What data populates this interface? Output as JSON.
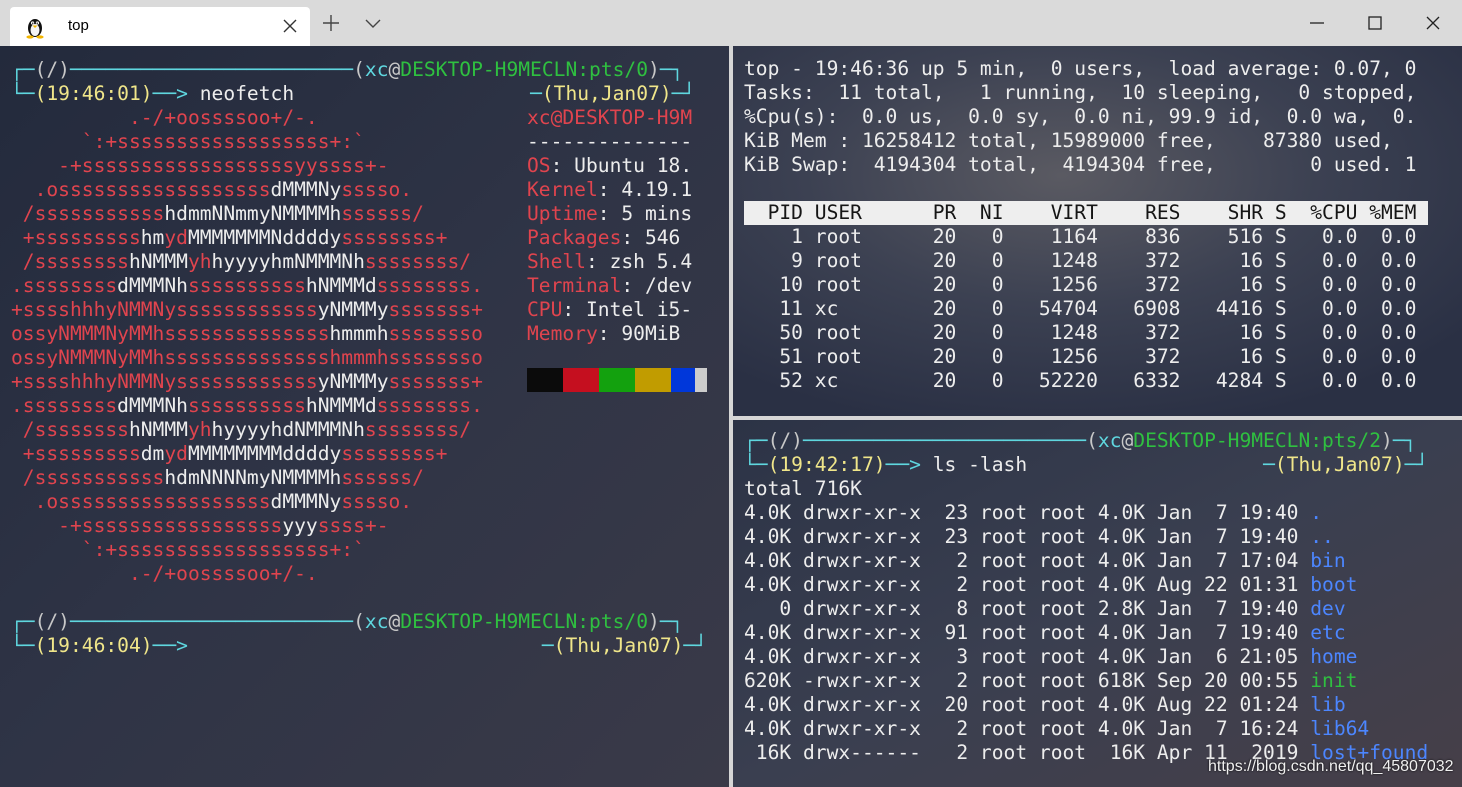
{
  "window": {
    "tab_title": "top",
    "tab_icon": "linux-penguin-icon",
    "new_tab_icon": "plus-icon",
    "dropdown_icon": "chevron-down-icon"
  },
  "colors": {
    "cyan": "#5fd7df",
    "green": "#2fc040",
    "yellow": "#f0e68a",
    "red": "#e0444e",
    "blue": "#4c86ff"
  },
  "left_pane": {
    "prompt1": {
      "path": "(/)",
      "user": "xc",
      "at": "@",
      "host": "DESKTOP-H9MECLN:pts/0",
      "time": "(19:46:01)",
      "arrow": "──>",
      "command": " neofetch",
      "date": "(Thu,Jan07)"
    },
    "logo_lines": [
      "          .-/+oossssoo+/-.",
      "      `:+ssssssssssssssssss+:`",
      "    -+ssssssssssssssssssyyssss+-",
      "  .ossssssssssssssssss",
      " /sssssssssss",
      " +sssssssss",
      " /ssssssss",
      ".ssssssss",
      "+sssshhhyNMMNy",
      "ossyNMMMNyMMh",
      "ossyNMMMNyMMh",
      "+sssshhhyNMMNy",
      ".ssssssss",
      " /ssssssss",
      " +sssssssss",
      " /sssssssssss",
      "  .ossssssssssssssssss",
      "    -+sssssssssssssssss",
      "      `:+ssssssssssssssssss+:`",
      "          .-/+oossssoo+/-."
    ],
    "logo_full": [
      [
        [
          "r",
          "          .-/+oossssoo+/-."
        ]
      ],
      [
        [
          "r",
          "      `:+ssssssssssssssssss+:`"
        ]
      ],
      [
        [
          "r",
          "    -+ssssssssssssssssssyyssss+-"
        ]
      ],
      [
        [
          "r",
          "  .ossssssssssssssssss"
        ],
        [
          "w",
          "dMMMNy"
        ],
        [
          "r",
          "sssso."
        ]
      ],
      [
        [
          "r",
          " /sssssssssss"
        ],
        [
          "w",
          "hdmmNNmmyNMMMMh"
        ],
        [
          "r",
          "ssssss/"
        ]
      ],
      [
        [
          "r",
          " +sssssssss"
        ],
        [
          "w",
          "hm"
        ],
        [
          "r",
          "yd"
        ],
        [
          "w",
          "MMMMMMMNddddy"
        ],
        [
          "r",
          "ssssssss+"
        ]
      ],
      [
        [
          "r",
          " /ssssssss"
        ],
        [
          "w",
          "hNMMM"
        ],
        [
          "r",
          "yh"
        ],
        [
          "w",
          "hyyyyhmNMMMNh"
        ],
        [
          "r",
          "ssssssss/"
        ]
      ],
      [
        [
          "r",
          ".ssssssss"
        ],
        [
          "w",
          "dMMMNh"
        ],
        [
          "r",
          "ssssssssss"
        ],
        [
          "w",
          "hNMMMd"
        ],
        [
          "r",
          "ssssssss."
        ]
      ],
      [
        [
          "r",
          "+sssshhhyNMMNy"
        ],
        [
          "r",
          "ssssssssssss"
        ],
        [
          "w",
          "yNMMMy"
        ],
        [
          "r",
          "sssssss+"
        ]
      ],
      [
        [
          "r",
          "ossyNMMMNyMMh"
        ],
        [
          "r",
          "ssssssssssssss"
        ],
        [
          "w",
          "hmmmh"
        ],
        [
          "r",
          "ssssssso"
        ]
      ],
      [
        [
          "r",
          "ossyNMMMNyMMh"
        ],
        [
          "r",
          "sssssssssssssshmmmh"
        ],
        [
          "r",
          "ssssssso"
        ]
      ],
      [
        [
          "r",
          "+sssshhhyNMMNy"
        ],
        [
          "r",
          "ssssssssssss"
        ],
        [
          "w",
          "yNMMMy"
        ],
        [
          "r",
          "sssssss+"
        ]
      ],
      [
        [
          "r",
          ".ssssssss"
        ],
        [
          "w",
          "dMMMNh"
        ],
        [
          "r",
          "ssssssssss"
        ],
        [
          "w",
          "hNMMMd"
        ],
        [
          "r",
          "ssssssss."
        ]
      ],
      [
        [
          "r",
          " /ssssssss"
        ],
        [
          "w",
          "hNMMM"
        ],
        [
          "r",
          "yh"
        ],
        [
          "w",
          "hyyyyhdNMMMNh"
        ],
        [
          "r",
          "ssssssss/"
        ]
      ],
      [
        [
          "r",
          " +sssssssss"
        ],
        [
          "w",
          "dm"
        ],
        [
          "r",
          "yd"
        ],
        [
          "w",
          "MMMMMMMMddddy"
        ],
        [
          "r",
          "ssssssss+"
        ]
      ],
      [
        [
          "r",
          " /sssssssssss"
        ],
        [
          "w",
          "hdmNNNNmyNMMMMh"
        ],
        [
          "r",
          "ssssss/"
        ]
      ],
      [
        [
          "r",
          "  .ossssssssssssssssss"
        ],
        [
          "w",
          "dMMMNy"
        ],
        [
          "r",
          "sssso."
        ]
      ],
      [
        [
          "r",
          "    -+sssssssssssssssss"
        ],
        [
          "w",
          "yyy"
        ],
        [
          "r",
          "ssss+-"
        ]
      ],
      [
        [
          "r",
          "      `:+ssssssssssssssssss+:`"
        ]
      ],
      [
        [
          "r",
          "          .-/+oossssoo+/-."
        ]
      ]
    ],
    "info": {
      "userhost": "xc@DESKTOP-H9M",
      "separator": "--------------",
      "items": [
        {
          "key": "OS",
          "value": ": Ubuntu 18."
        },
        {
          "key": "Kernel",
          "value": ": 4.19.1"
        },
        {
          "key": "Uptime",
          "value": ": 5 mins"
        },
        {
          "key": "Packages",
          "value": ": 546"
        },
        {
          "key": "Shell",
          "value": ": zsh 5.4"
        },
        {
          "key": "Terminal",
          "value": ": /dev"
        },
        {
          "key": "CPU",
          "value": ": Intel i5-"
        },
        {
          "key": "Memory",
          "value": ": 90MiB"
        }
      ],
      "swatch_colors": [
        "#0b0b0b",
        "#c50f1f",
        "#13a10e",
        "#c19c00",
        "#0037da",
        "#cccccc"
      ]
    },
    "prompt2": {
      "path": "(/)",
      "user": "xc",
      "at": "@",
      "host": "DESKTOP-H9MECLN:pts/0",
      "time": "(19:46:04)",
      "arrow": "──>",
      "date": "(Thu,Jan07)"
    }
  },
  "top_pane": {
    "summary": [
      "top - 19:46:36 up 5 min,  0 users,  load average: 0.07, 0",
      "Tasks:  11 total,   1 running,  10 sleeping,   0 stopped,",
      "%Cpu(s):  0.0 us,  0.0 sy,  0.0 ni, 99.9 id,  0.0 wa,  0.",
      "KiB Mem : 16258412 total, 15989000 free,    87380 used,",
      "KiB Swap:  4194304 total,  4194304 free,        0 used. 1"
    ],
    "header": "  PID USER      PR  NI    VIRT    RES    SHR S  %CPU %MEM",
    "rows": [
      "    1 root      20   0    1164    836    516 S   0.0  0.0",
      "    9 root      20   0    1248    372     16 S   0.0  0.0",
      "   10 root      20   0    1256    372     16 S   0.0  0.0",
      "   11 xc        20   0   54704   6908   4416 S   0.0  0.0",
      "   50 root      20   0    1248    372     16 S   0.0  0.0",
      "   51 root      20   0    1256    372     16 S   0.0  0.0",
      "   52 xc        20   0   52220   6332   4284 S   0.0  0.0"
    ]
  },
  "ls_pane": {
    "prompt": {
      "path": "(/)",
      "user": "xc",
      "at": "@",
      "host": "DESKTOP-H9MECLN:pts/2",
      "time": "(19:42:17)",
      "arrow": "──>",
      "command": " ls -lash",
      "date": "(Thu,Jan07)"
    },
    "total": "total 716K",
    "entries": [
      {
        "text": "4.0K drwxr-xr-x  23 root root 4.0K Jan  7 19:40 ",
        "name": ".",
        "type": "dir"
      },
      {
        "text": "4.0K drwxr-xr-x  23 root root 4.0K Jan  7 19:40 ",
        "name": "..",
        "type": "dir"
      },
      {
        "text": "4.0K drwxr-xr-x   2 root root 4.0K Jan  7 17:04 ",
        "name": "bin",
        "type": "dir"
      },
      {
        "text": "4.0K drwxr-xr-x   2 root root 4.0K Aug 22 01:31 ",
        "name": "boot",
        "type": "dir"
      },
      {
        "text": "   0 drwxr-xr-x   8 root root 2.8K Jan  7 19:40 ",
        "name": "dev",
        "type": "dir"
      },
      {
        "text": "4.0K drwxr-xr-x  91 root root 4.0K Jan  7 19:40 ",
        "name": "etc",
        "type": "dir"
      },
      {
        "text": "4.0K drwxr-xr-x   3 root root 4.0K Jan  6 21:05 ",
        "name": "home",
        "type": "dir"
      },
      {
        "text": "620K -rwxr-xr-x   2 root root 618K Sep 20 00:55 ",
        "name": "init",
        "type": "exec"
      },
      {
        "text": "4.0K drwxr-xr-x  20 root root 4.0K Aug 22 01:24 ",
        "name": "lib",
        "type": "dir"
      },
      {
        "text": "4.0K drwxr-xr-x   2 root root 4.0K Jan  7 16:24 ",
        "name": "lib64",
        "type": "dir"
      },
      {
        "text": " 16K drwx------   2 root root  16K Apr 11  2019 ",
        "name": "lost+found",
        "type": "dir"
      }
    ]
  },
  "watermark": "https://blog.csdn.net/qq_45807032"
}
